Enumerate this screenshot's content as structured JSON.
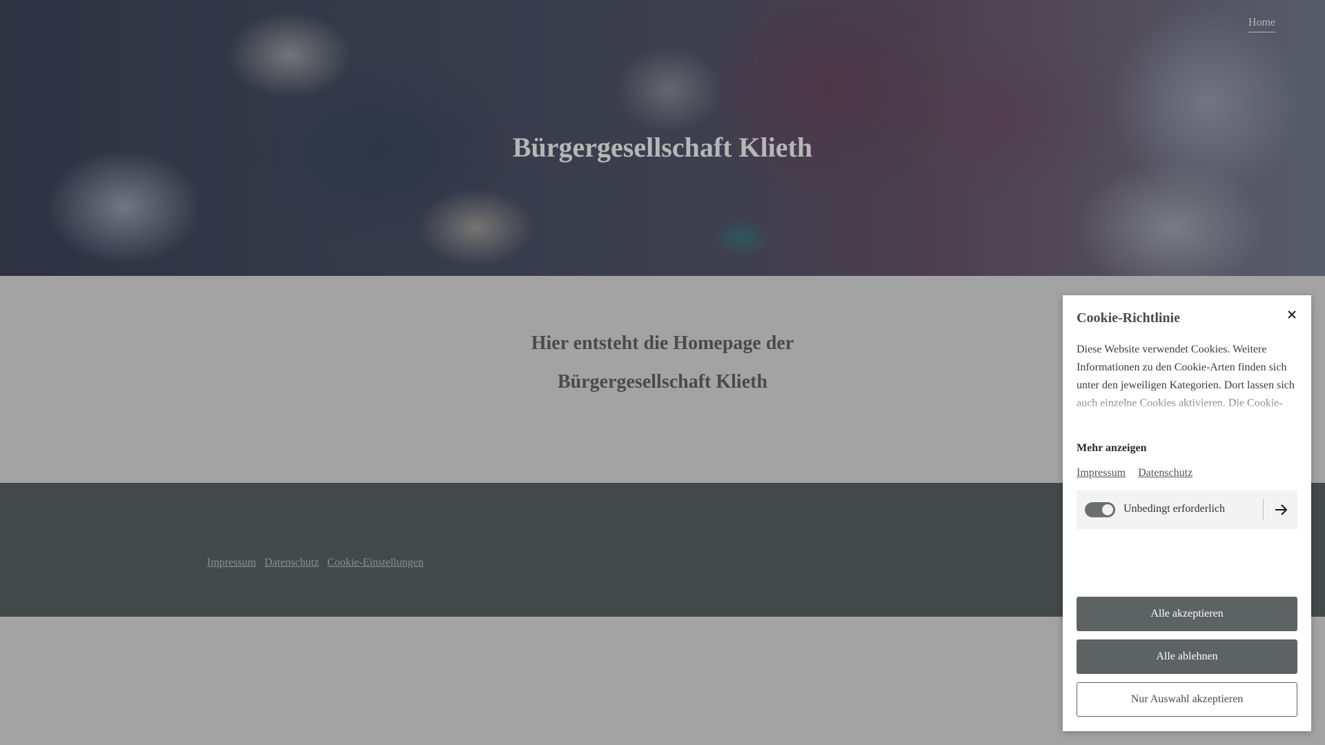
{
  "nav": {
    "home_label": "Home"
  },
  "hero": {
    "title": "Bürgergesellschaft Klieth"
  },
  "main": {
    "heading_line1": "Hier entsteht die Homepage der",
    "heading_line2": "Bürgergesellschaft Klieth"
  },
  "footer": {
    "links": [
      "Impressum",
      "Datenschutz",
      "Cookie-Einstellungen"
    ]
  },
  "cookie_banner": {
    "title": "Cookie-Richtlinie",
    "close_icon": "close-icon",
    "text": "Diese Website verwendet Cookies. Weitere Informationen zu den Cookie-Arten finden sich unter den jeweiligen Kategorien. Dort lassen sich auch einzelne Cookies aktivieren. Die Cookie-Einstellungen können jederzeit über den Link im",
    "show_more": "Mehr anzeigen",
    "links": [
      "Impressum",
      "Datenschutz"
    ],
    "category": {
      "label": "Unbedingt erforderlich",
      "enabled": true,
      "arrow_icon": "arrow-right-icon"
    },
    "buttons": {
      "accept_all": "Alle akzeptieren",
      "reject_all": "Alle ablehnen",
      "accept_selection": "Nur Auswahl akzeptieren"
    }
  },
  "colors": {
    "overlay_gray": "#a3a3a3",
    "footer_bg": "#434849",
    "button_dark": "#5d6263",
    "toggle_on": "#6b6f70"
  }
}
